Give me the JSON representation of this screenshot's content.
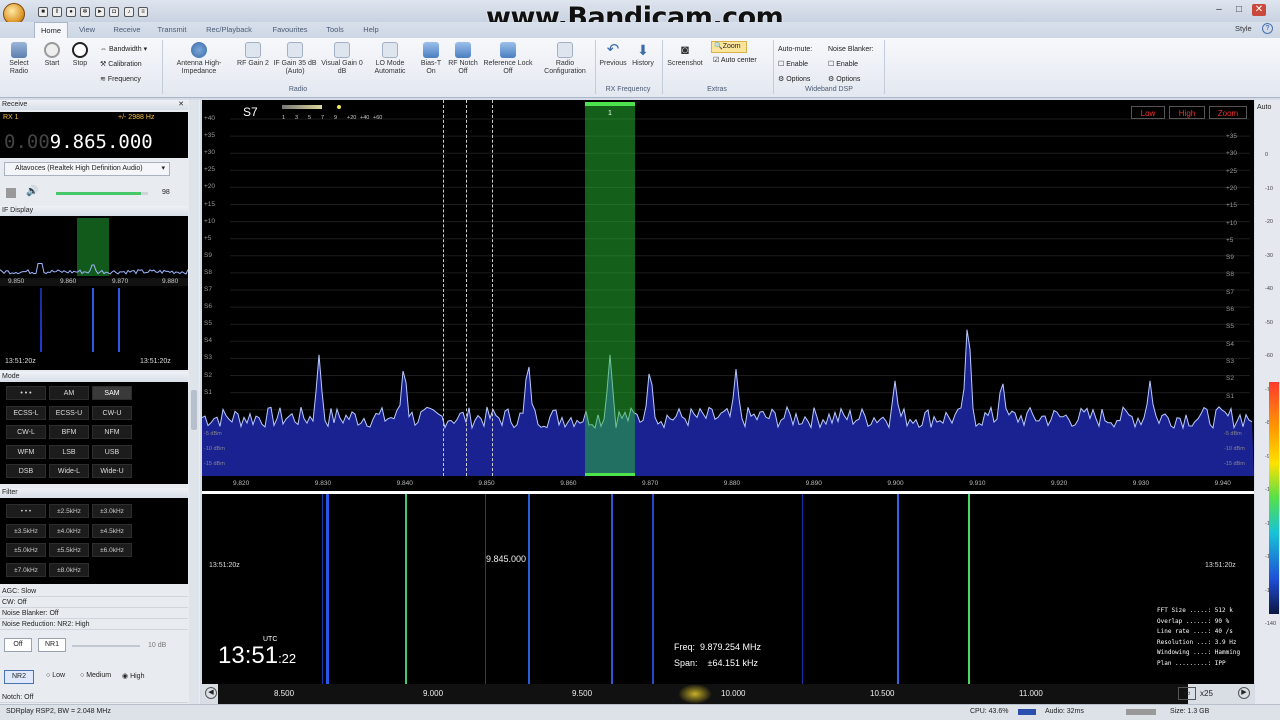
{
  "window": {
    "watermark": "www.Bandicam.com",
    "style_label": "Style",
    "help": "?"
  },
  "tabs": [
    "Home",
    "View",
    "Receive",
    "Transmit",
    "Rec/Playback",
    "Favourites",
    "Tools",
    "Help"
  ],
  "ribbon": {
    "buttons": [
      "Select Radio",
      "Start",
      "Stop",
      "Antenna High-Impedance",
      "RF Gain 2",
      "IF Gain 35 dB (Auto)",
      "Visual Gain 0 dB",
      "LO Mode Automatic",
      "Bias-T On",
      "RF Notch Off",
      "Reference Lock Off",
      "Radio Configuration",
      "Previous",
      "History",
      "Screenshot"
    ],
    "bandwidth": "Bandwidth",
    "calibration": "Calibration",
    "frequency": "Frequency",
    "zoom": "Zoom",
    "autocenter": "Auto center",
    "automute": "Auto-mute:",
    "noiseblanker": "Noise Blanker:",
    "enable": "Enable",
    "options": "Options",
    "groups": [
      "Radio",
      "RX Frequency",
      "Extras",
      "Wideband DSP"
    ]
  },
  "receive": {
    "title": "Receive",
    "rx": "RX 1",
    "offset": "+/- 2988 Hz",
    "freq_dim": "0.00",
    "freq": "9.865.000",
    "audio_device": "Altavoces (Realtek High Definition Audio)",
    "volume": "98",
    "volume_level": 0.92
  },
  "ifdisplay": {
    "title": "IF Display",
    "ticks": [
      "9.850",
      "9.860",
      "9.870",
      "9.880"
    ],
    "time_l": "13:51:20z",
    "time_r": "13:51:20z"
  },
  "mode": {
    "title": "Mode",
    "buttons": [
      "• • •",
      "AM",
      "SAM",
      "ECSS-L",
      "ECSS-U",
      "CW-U",
      "CW-L",
      "BFM",
      "NFM",
      "WFM",
      "LSB",
      "USB",
      "DSB",
      "Wide-L",
      "Wide-U"
    ],
    "selected": "SAM"
  },
  "filter": {
    "title": "Filter",
    "buttons": [
      "• • •",
      "±2.5kHz",
      "±3.0kHz",
      "±3.5kHz",
      "±4.0kHz",
      "±4.5kHz",
      "±5.0kHz",
      "±5.5kHz",
      "±6.0kHz",
      "±7.0kHz",
      "±8.0kHz"
    ]
  },
  "settings": [
    "AGC: Slow",
    "CW: Off",
    "Noise Blanker: Off",
    "Noise Reduction: NR2: High"
  ],
  "nr": {
    "off": "Off",
    "nr1": "NR1",
    "nr2": "NR2",
    "db": "10 dB",
    "low": "Low",
    "medium": "Medium",
    "high": "High",
    "notch": "Notch: Off"
  },
  "spectrum": {
    "smeter": "S7",
    "smeter_ticks": [
      "1",
      "3",
      "5",
      "7",
      "9",
      "+20",
      "+40",
      "+60"
    ],
    "marker": "1",
    "low": "Low",
    "high": "High",
    "zoom": "Zoom",
    "left_scale": [
      "+40",
      "+35",
      "+30",
      "+25",
      "+20",
      "+15",
      "+10",
      "+5",
      "S9",
      "S8",
      "S7",
      "S6",
      "S5",
      "S4",
      "S3",
      "S2",
      "S1"
    ],
    "dbm_labels": [
      "-5 dBm",
      "-10 dBm",
      "-15 dBm"
    ],
    "right_scale": [
      "+35",
      "+30",
      "+25",
      "+20",
      "+15",
      "+10",
      "+5",
      "S9",
      "S8",
      "S7",
      "S6",
      "S5",
      "S4",
      "S3",
      "S2",
      "S1"
    ],
    "freq_ticks": [
      "9.820",
      "9.830",
      "9.840",
      "9.850",
      "9.860",
      "9.870",
      "9.880",
      "9.890",
      "9.900",
      "9.910",
      "9.920",
      "9.930",
      "9.940"
    ]
  },
  "waterfall": {
    "time_l": "13:51:20z",
    "time_r": "13:51:20z",
    "cursor": "9.845.000",
    "clock_h": "13:51",
    "clock_s": ":22",
    "utc": "UTC",
    "freq": "Freq:  9.879.254 MHz",
    "span": "Span:    ±64.151 kHz",
    "info": [
      "FFT Size .....: 512 k",
      "Overlap ......: 90 %",
      "Line rate ....: 40 /s",
      "Resolution ...: 3.9 Hz",
      "Windowing ....: Hamming",
      "Plan .........: IPP"
    ]
  },
  "axis": {
    "ticks": [
      "8.500",
      "9.000",
      "9.500",
      "10.000",
      "10.500",
      "11.000"
    ],
    "zoom": "x25"
  },
  "rightpanel": {
    "auto": "Auto",
    "scale": [
      "0",
      "-10",
      "-20",
      "-30",
      "-40",
      "-50",
      "-60",
      "-70",
      "-80",
      "-90",
      "-100",
      "-110",
      "-120",
      "-130",
      "-140"
    ]
  },
  "status": {
    "left": "SDRplay RSP2, BW = 2.048 MHz",
    "cpu": "CPU: 43.6%",
    "audio": "Audio: 32ms",
    "size": "Size: 1.3 GB"
  }
}
